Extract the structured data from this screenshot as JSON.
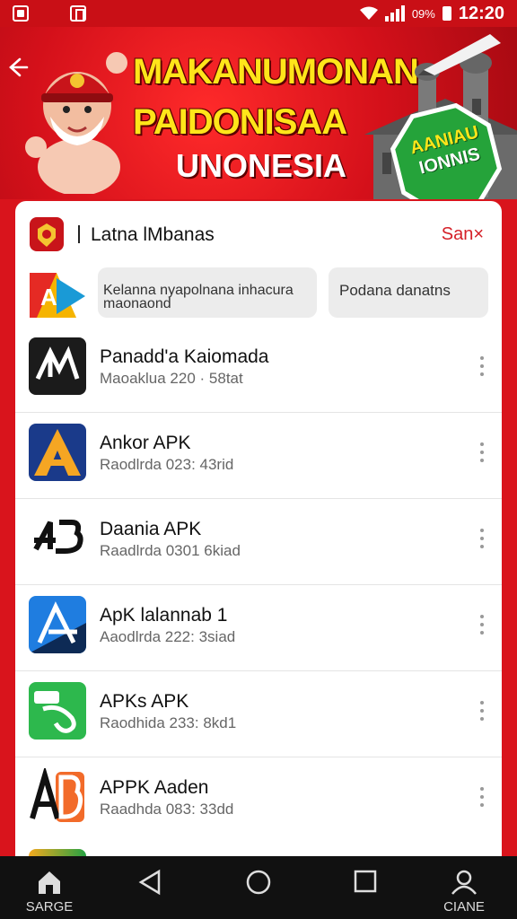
{
  "status_bar": {
    "battery_text": "09%",
    "time": "12:20"
  },
  "banner": {
    "title_line1": "MAKANUMONAN",
    "title_line2": "PAIDONISAA",
    "subtitle": "UNONESIA",
    "badge_line1": "AANIAU",
    "badge_line2": "IONNIS"
  },
  "card": {
    "title": "Latna lMbanas",
    "action": "San×"
  },
  "search": {
    "primary_line1": "Kelanna nyapolnana inhacura",
    "primary_line2": "maonaond",
    "secondary": "Podana danatns"
  },
  "apps": [
    {
      "name": "Panadd'a  Kaiomada",
      "meta": "Maoaklua  220 · 58tat",
      "icon": "ap-icon"
    },
    {
      "name": "Ankor APK",
      "meta": "Raodlrda  023: 43rid",
      "icon": "a-logo-icon"
    },
    {
      "name": "Daania APK",
      "meta": "Raadlrda  0301 6kiad",
      "icon": "4b-logo-icon"
    },
    {
      "name": "ApK lalannab 1",
      "meta": "Aaodlrda  222: 3siad",
      "icon": "a-triangle-icon"
    },
    {
      "name": "APKs APK",
      "meta": "Raodhida  233: 8kd1",
      "icon": "green-apk-icon"
    },
    {
      "name": "APPK Aaden",
      "meta": "Raadhda  083: 33dd",
      "icon": "ab-logo-icon"
    }
  ],
  "nav": {
    "home_label": "SARGE",
    "profile_label": "CIANE"
  }
}
